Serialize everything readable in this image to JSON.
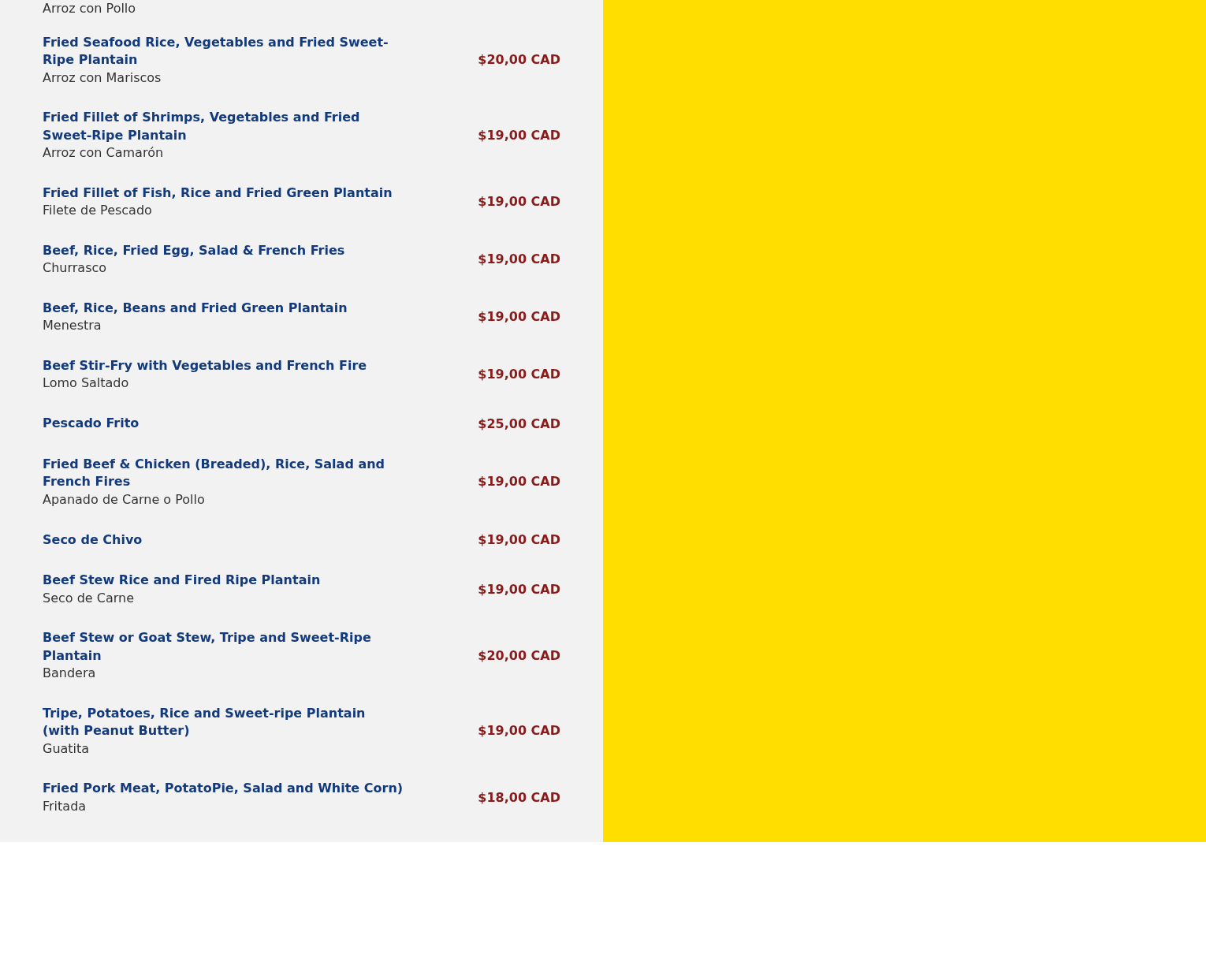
{
  "menu_items": [
    {
      "name": "Fried Seafood Rice, Vegetables and Fried Sweet-Ripe Plantain",
      "subtitle": "Arroz con Mariscos",
      "price": "$20,00 CAD"
    },
    {
      "name": "Fried Fillet of Shrimps, Vegetables and Fried Sweet-Ripe Plantain",
      "subtitle": "Arroz con Camarón",
      "price": "$19,00 CAD"
    },
    {
      "name": "Fried Fillet of Fish, Rice and Fried Green Plantain",
      "subtitle": "Filete de Pescado",
      "price": "$19,00 CAD"
    },
    {
      "name": "Beef, Rice, Fried Egg, Salad & French Fries",
      "subtitle": "Churrasco",
      "price": "$19,00 CAD"
    },
    {
      "name": "Beef, Rice, Beans and Fried Green Plantain",
      "subtitle": "Menestra",
      "price": "$19,00 CAD"
    },
    {
      "name": "Beef Stir-Fry with Vegetables and French Fire",
      "subtitle": "Lomo Saltado",
      "price": "$19,00 CAD"
    },
    {
      "name": "Pescado Frito",
      "price": "$25,00 CAD"
    },
    {
      "name": "Fried Beef & Chicken (Breaded), Rice, Salad and French Fires",
      "subtitle": "Apanado de Carne o Pollo",
      "price": "$19,00 CAD"
    },
    {
      "name": "Seco de Chivo",
      "price": "$19,00 CAD"
    },
    {
      "name": "Beef Stew Rice and Fired Ripe Plantain",
      "subtitle": "Seco de Carne",
      "price": "$19,00 CAD"
    },
    {
      "name": "Beef Stew or Goat Stew, Tripe and Sweet-Ripe Plantain",
      "subtitle": "Bandera",
      "price": "$20,00 CAD"
    },
    {
      "name": "Tripe, Potatoes, Rice and Sweet-ripe Plantain (with Peanut Butter)",
      "subtitle": "Guatita",
      "price": "$19,00 CAD"
    },
    {
      "name": "Fried Pork Meat, PotatoPie, Salad and White Corn)",
      "subtitle": "Fritada",
      "price": "$18,00 CAD"
    }
  ],
  "top_subtitle": "Arroz con Pollo"
}
